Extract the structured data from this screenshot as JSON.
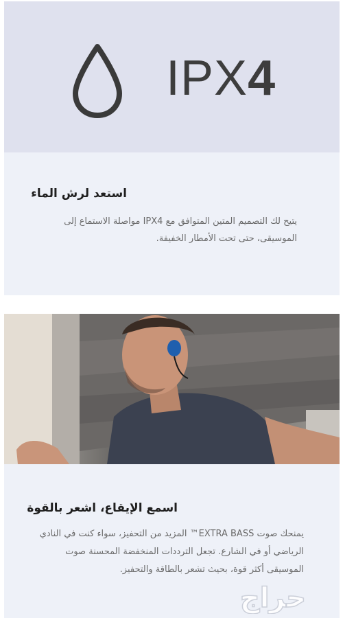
{
  "feature_1": {
    "badge": {
      "prefix": "IPX",
      "digit": "4",
      "icon": "water-drop-icon"
    },
    "title": "استعد لرش الماء",
    "description": "يتيح لك التصميم المتين المتوافق مع IPX4 مواصلة الاستماع إلى الموسيقى، حتى تحت الأمطار الخفيفة."
  },
  "feature_2": {
    "image": "runner-with-wireless-earphones",
    "title": "اسمع الإيقاع، اشعر بالقوة",
    "description": "يمنحك صوت EXTRA BASS™ المزيد من التحفيز، سواء كنت في النادي الرياضي أو في الشارع. تجعل الترددات المنخفضة المحسنة صوت الموسيقى أكثر قوة، بحيث تشعر بالطاقة والتحفيز."
  },
  "watermark": {
    "text": "حراج"
  },
  "colors": {
    "card_background": "#eef1f8",
    "banner_background": "#dfe1ee",
    "title": "#1f1f1f",
    "body_text": "#6a6a6a",
    "earphone_accent": "#1f5fae"
  }
}
